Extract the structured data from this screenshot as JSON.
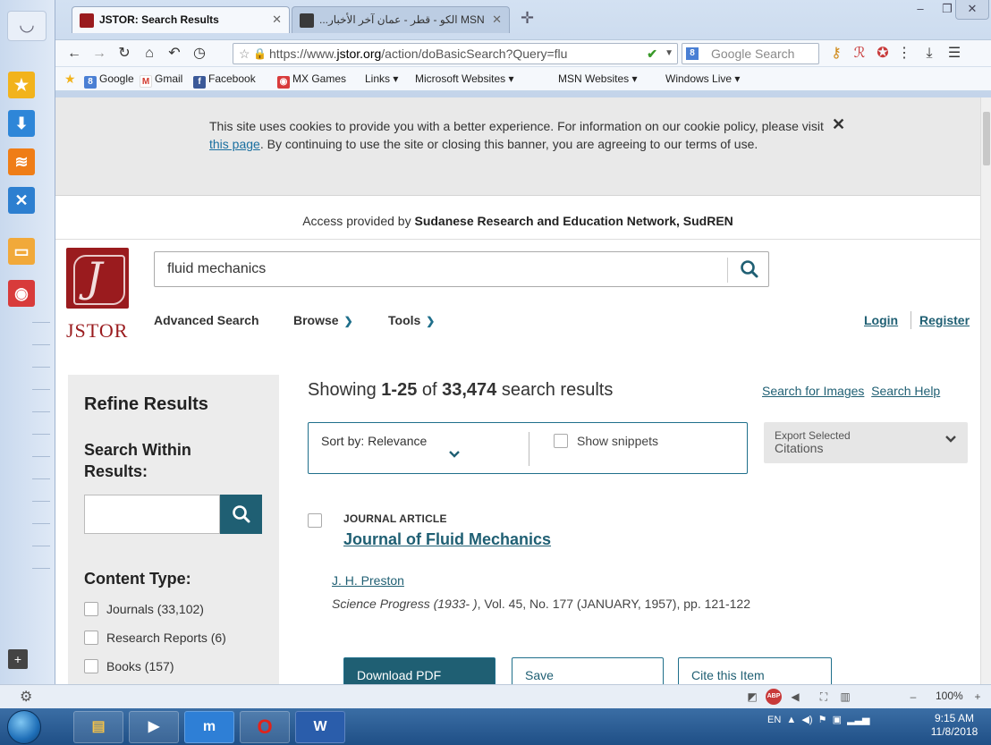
{
  "browser": {
    "tabs": [
      {
        "title": "JSTOR: Search Results",
        "active": true
      },
      {
        "title": "...الكو - قطر - عمان آخر الأخبار MSN",
        "active": false
      }
    ],
    "url": {
      "prefix": "https://www.",
      "domain": "jstor.org",
      "path": "/action/doBasicSearch?Query=flu"
    },
    "search_placeholder": "Google Search",
    "bookmarks": [
      "Google",
      "Gmail",
      "Facebook",
      "MX Games",
      "Links ▾",
      "Microsoft Websites ▾",
      "MSN Websites ▾",
      "Windows Live ▾"
    ]
  },
  "cookie_banner": {
    "text_before": "This site uses cookies to provide you with a better experience. For information on our cookie policy, please visit ",
    "link": "this page",
    "text_after": ". By continuing to use the site or closing this banner, you are agreeing to our terms of use.",
    "close": "✕"
  },
  "access": {
    "prefix": "Access provided by ",
    "org": "Sudanese Research and Education Network, SudREN"
  },
  "logo": {
    "word": "JSTOR"
  },
  "search": {
    "value": "fluid mechanics"
  },
  "nav": {
    "advanced": "Advanced Search",
    "browse": "Browse",
    "tools": "Tools",
    "login": "Login",
    "register": "Register"
  },
  "sidebar": {
    "refine": "Refine Results",
    "search_within": "Search Within Results:",
    "content_type": "Content Type:",
    "types": [
      "Journals (33,102)",
      "Research Reports (6)",
      "Books (157)"
    ]
  },
  "results": {
    "showing_prefix": "Showing ",
    "range": "1-25",
    "of": " of ",
    "total": "33,474",
    "suffix": " search results",
    "search_images": "Search for Images",
    "search_help": "Search Help",
    "sort": "Sort by: Relevance",
    "snippets": "Show snippets",
    "export_line1": "Export Selected",
    "export_line2": "Citations",
    "items": [
      {
        "type": "JOURNAL ARTICLE",
        "title": "Journal of Fluid Mechanics",
        "author": "J. H. Preston",
        "journal": "Science Progress (1933- )",
        "details": ", Vol. 45, No. 177 (JANUARY, 1957), pp. 121-122"
      }
    ],
    "actions": [
      "Download PDF",
      "Save",
      "Cite this Item"
    ]
  },
  "status": {
    "zoom": "100%"
  },
  "taskbar": {
    "lang": "EN",
    "time": "9:15 AM",
    "date": "11/8/2018"
  }
}
